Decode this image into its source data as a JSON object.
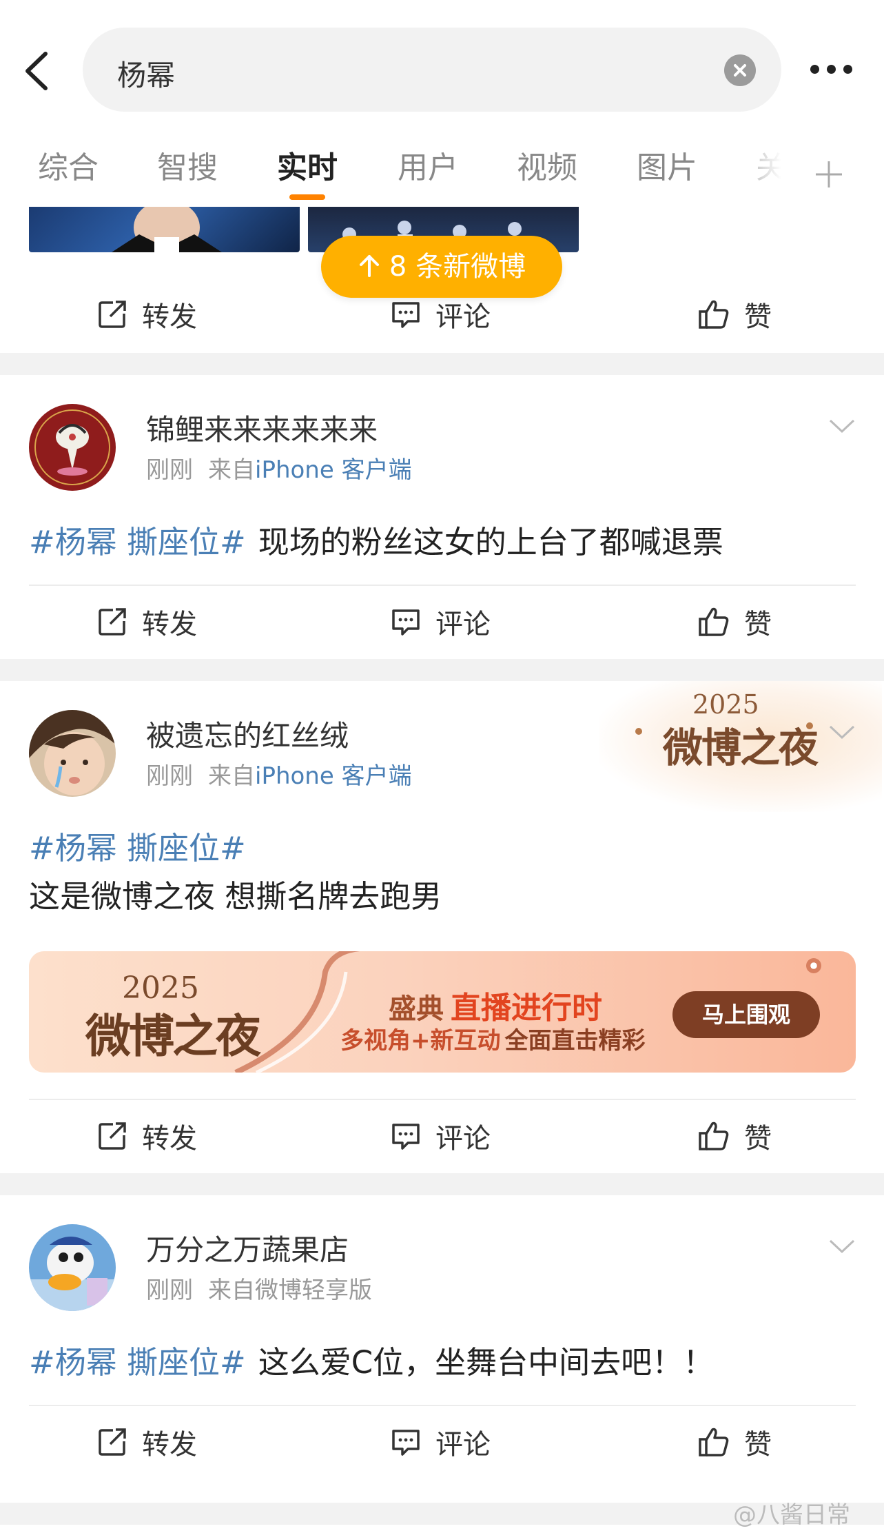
{
  "search": {
    "query": "杨幂"
  },
  "tabs": [
    {
      "label": "综合"
    },
    {
      "label": "智搜"
    },
    {
      "label": "实时"
    },
    {
      "label": "用户"
    },
    {
      "label": "视频"
    },
    {
      "label": "图片"
    },
    {
      "label": "关"
    }
  ],
  "active_tab": "实时",
  "new_posts_banner": "8 条新微博",
  "actions": {
    "repost": "转发",
    "comment": "评论",
    "like": "赞"
  },
  "posts": [
    {
      "username": "锦鲤来来来来来来",
      "time": "刚刚",
      "source_prefix": "来自",
      "source": "iPhone 客户端",
      "hashtag": "#杨幂 撕座位#",
      "text": "现场的粉丝这女的上台了都喊退票"
    },
    {
      "username": "被遗忘的红丝绒",
      "time": "刚刚",
      "source_prefix": "来自",
      "source": "iPhone 客户端",
      "hashtag": "#杨幂 撕座位#",
      "text": "这是微博之夜 想撕名牌去跑男",
      "badge": {
        "year": "2025",
        "title": "微博之夜"
      },
      "promo": {
        "year": "2025",
        "title": "微博之夜",
        "line1_a": "盛典",
        "line1_b": "直播进行时",
        "line2_a": "多视角+新互动",
        "line2_b": "全面直击精彩",
        "button": "马上围观"
      }
    },
    {
      "username": "万分之万蔬果店",
      "time": "刚刚",
      "source_prefix": "来自",
      "source": "微博轻享版",
      "hashtag": "#杨幂 撕座位#",
      "text": "这么爱C位，坐舞台中间去吧！！"
    }
  ],
  "watermark": "@八酱日常",
  "colors": {
    "accent": "#ff8200",
    "banner": "#ffb000",
    "link": "#4a7fb5"
  }
}
